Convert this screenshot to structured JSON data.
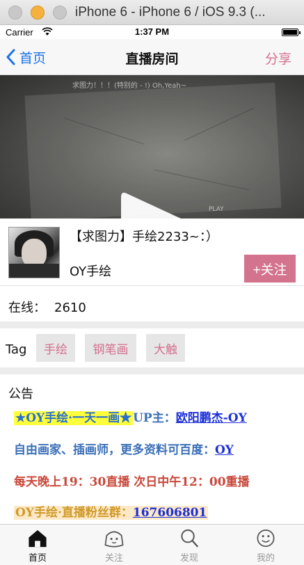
{
  "simulator": {
    "title": "iPhone 6 - iPhone 6 / iOS 9.3 (..."
  },
  "status_bar": {
    "carrier": "Carrier",
    "time": "1:37 PM"
  },
  "nav": {
    "back_label": "首页",
    "title": "直播房间",
    "share_label": "分享"
  },
  "video": {
    "overlay_line1": "求图力！！！(特别的 - !) Oh,Yeah~",
    "overlay_line2": "PLAY"
  },
  "room": {
    "title": "【求图力】手绘2233~：）",
    "anchor_name": "OY手绘",
    "follow_label": "+关注"
  },
  "online": {
    "label": "在线：",
    "count": "2610"
  },
  "tags": {
    "label": "Tag",
    "items": [
      "手绘",
      "钢笔画",
      "大触"
    ]
  },
  "notice": {
    "title": "公告",
    "line1_highlight": "★OY手绘·一天一画★",
    "line1_prefix": "UP主：",
    "line1_link": "欧阳鹏杰-OY",
    "line2_text": "自由画家、插画师，更多资料可百度：",
    "line2_link": "OY",
    "line3_text": "每天晚上19：30直播 次日中午12：00重播",
    "line4_text": "OY手绘·直播粉丝群：",
    "line4_link": "167606801"
  },
  "tabbar": {
    "items": [
      "首页",
      "关注",
      "发现",
      "我的"
    ],
    "active_index": 0
  },
  "colors": {
    "accent_pink": "#d3738e",
    "ios_blue": "#1a73e8"
  }
}
